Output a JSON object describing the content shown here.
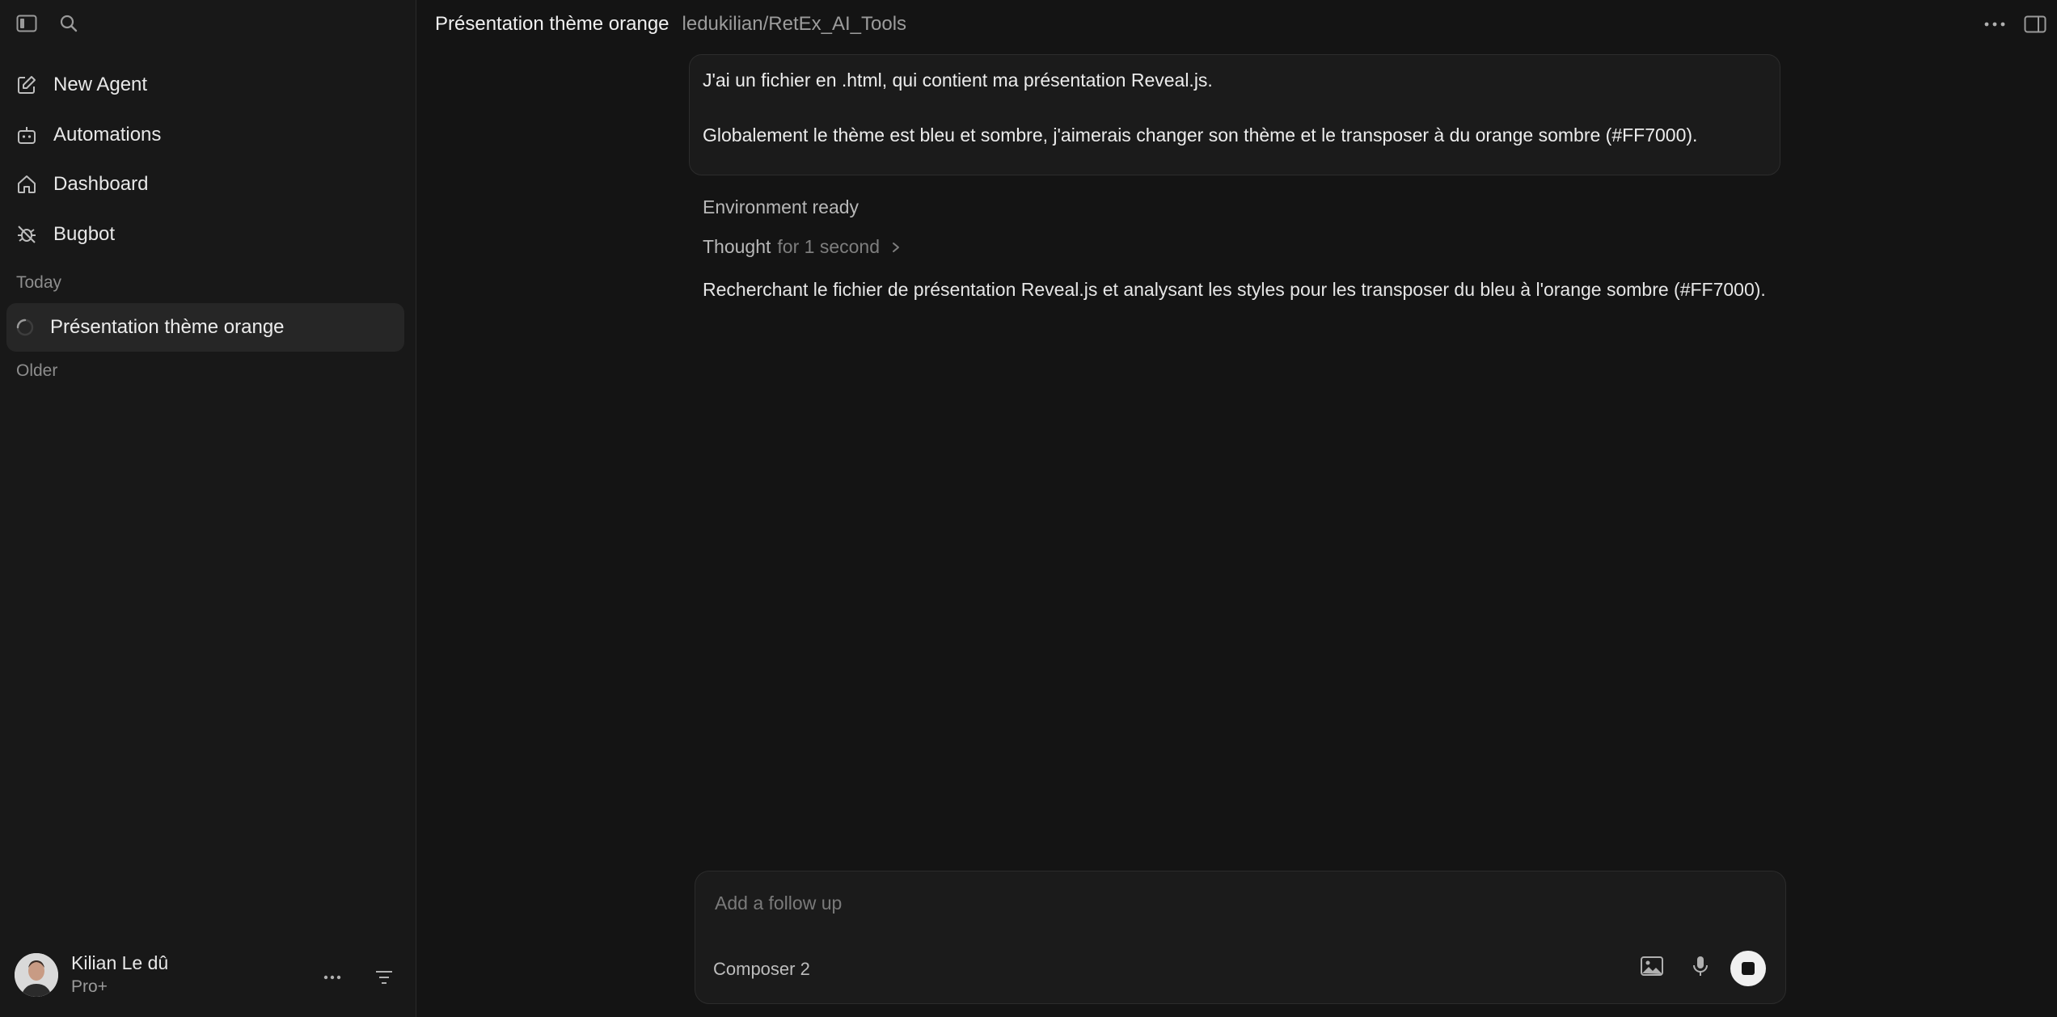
{
  "sidebar": {
    "nav": [
      {
        "label": "New Agent",
        "icon": "edit-icon"
      },
      {
        "label": "Automations",
        "icon": "robot-icon"
      },
      {
        "label": "Dashboard",
        "icon": "home-icon"
      },
      {
        "label": "Bugbot",
        "icon": "bug-off-icon"
      }
    ],
    "section_today": "Today",
    "active_chat": "Présentation thème orange",
    "section_older": "Older",
    "user": {
      "name": "Kilian Le dû",
      "plan": "Pro+"
    }
  },
  "header": {
    "title": "Présentation thème orange",
    "repo": "ledukilian/RetEx_AI_Tools"
  },
  "conversation": {
    "user_message": [
      "J'ai un fichier en .html, qui contient ma présentation Reveal.js.",
      "Globalement le thème est bleu et sombre, j'aimerais changer son thème et le transposer à du orange sombre (#FF7000)."
    ],
    "status": "Environment ready",
    "thought_label": "Thought",
    "thought_duration": "for 1 second",
    "response": "Recherchant le fichier de présentation Reveal.js et analysant les styles pour les transposer du bleu à l'orange sombre (#FF7000)."
  },
  "composer": {
    "placeholder": "Add a follow up",
    "model": "Composer 2"
  }
}
